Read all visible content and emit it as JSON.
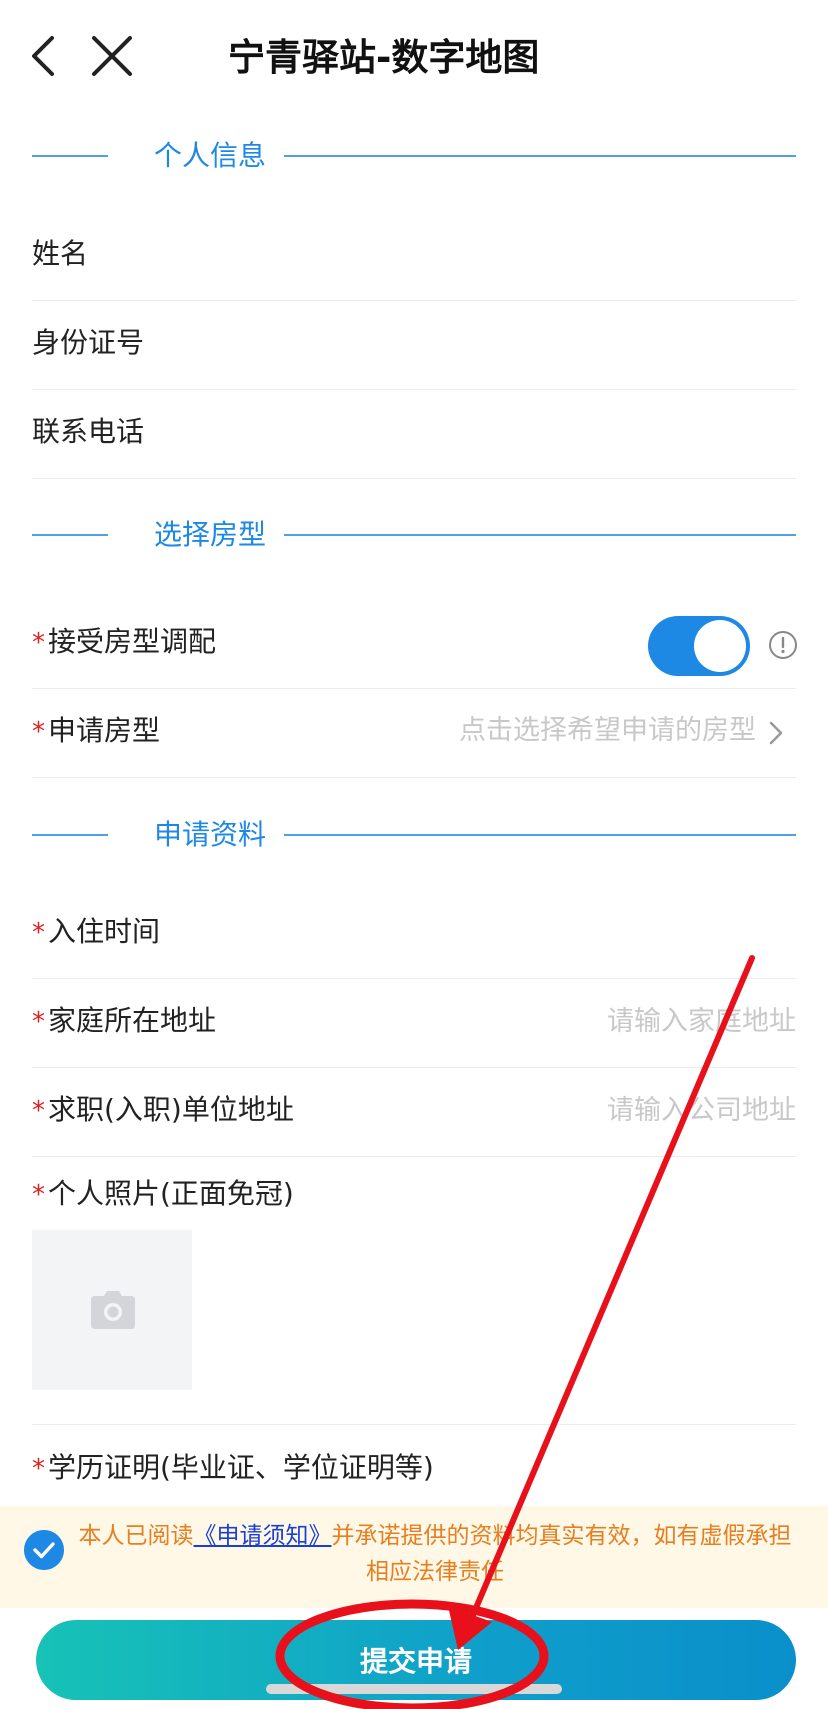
{
  "header": {
    "title": "宁青驿站-数字地图"
  },
  "sections": {
    "personal": "个人信息",
    "room": "选择房型",
    "materials": "申请资料"
  },
  "personal_fields": {
    "name_label": "姓名",
    "id_label": "身份证号",
    "phone_label": "联系电话"
  },
  "room_fields": {
    "required_mark": "*",
    "accept_label": "接受房型调配",
    "accept_toggle_on": true,
    "room_type_label": "申请房型",
    "room_type_placeholder": "点击选择希望申请的房型"
  },
  "material_fields": {
    "checkin_label": "入住时间",
    "home_address_label": "家庭所在地址",
    "home_address_placeholder": "请输入家庭地址",
    "work_address_label": "求职(入职)单位地址",
    "work_address_placeholder": "请输入公司地址",
    "photo_label": "个人照片(正面免冠)",
    "education_label": "学历证明(毕业证、学位证明等)"
  },
  "agreement": {
    "checked": true,
    "text_before": "本人已阅读",
    "link_text": "《申请须知》",
    "text_after": "并承诺提供的资料均真实有效，如有虚假承担相应法律责任"
  },
  "submit": {
    "label": "提交申请"
  },
  "colors": {
    "accent": "#1e88e5",
    "required": "#e02020",
    "agreement_text": "#e67e22",
    "annotation": "#e8101a"
  }
}
